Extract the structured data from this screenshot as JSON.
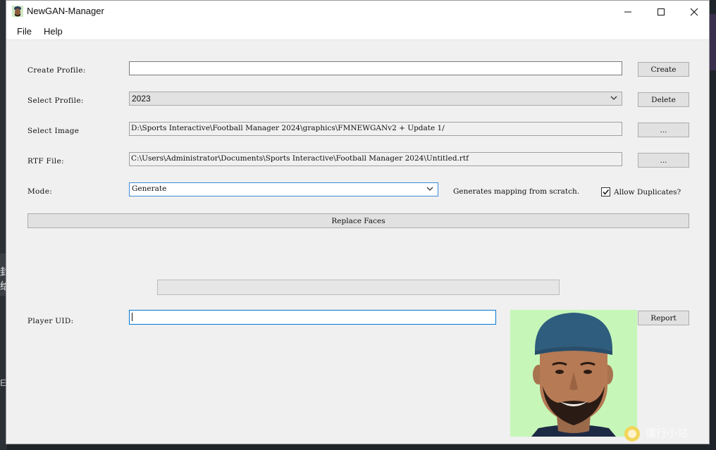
{
  "window": {
    "title": "NewGAN-Manager"
  },
  "menu": {
    "file": "File",
    "help": "Help"
  },
  "form": {
    "create_profile": {
      "label": "Create Profile:",
      "value": "",
      "button": "Create"
    },
    "select_profile": {
      "label": "Select Profile:",
      "value": "2023",
      "button": "Delete"
    },
    "select_image": {
      "label": "Select Image",
      "value": "D:\\Sports Interactive\\Football Manager 2024\\graphics\\FMNEWGANv2 + Update 1/",
      "button": "..."
    },
    "rtf_file": {
      "label": "RTF File:",
      "value": "C:\\Users\\Administrator\\Documents\\Sports Interactive\\Football Manager 2024\\Untitled.rtf",
      "button": "..."
    },
    "mode": {
      "label": "Mode:",
      "value": "Generate",
      "description": "Generates mapping from scratch.",
      "allow_duplicates_label": "Allow Duplicates?",
      "allow_duplicates_checked": true
    },
    "replace_button": "Replace Faces",
    "progress_fraction": 0,
    "player_uid": {
      "label": "Player UID:",
      "value": "",
      "button": "Report"
    }
  },
  "watermark_text": "懂行小站",
  "background_fragments": {
    "a": "封",
    "b": "给",
    "c": "E"
  },
  "colors": {
    "focus_border": "#0078d7",
    "photo_background": "#c6f7b9"
  },
  "icons": {
    "app": "newgan-app-icon",
    "minimize": "minimize-icon",
    "maximize": "maximize-icon",
    "close": "close-icon",
    "dropdown": "chevron-down-icon",
    "checkbox": "checkmark-icon"
  }
}
